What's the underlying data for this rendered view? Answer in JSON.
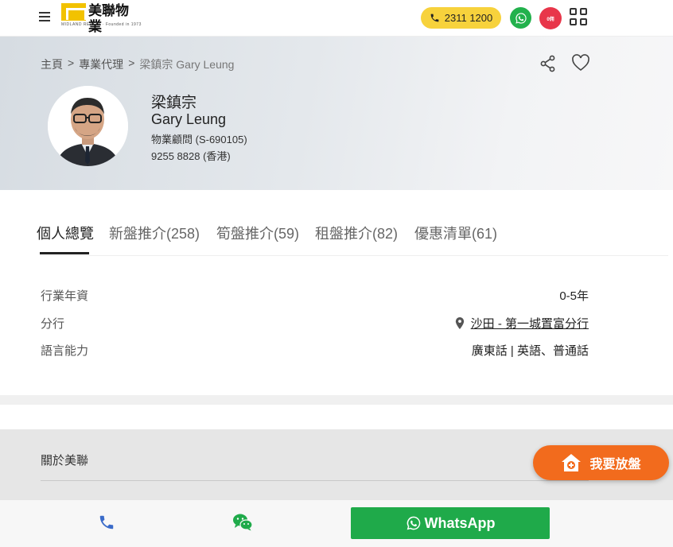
{
  "header": {
    "logo_text": "美聯物業",
    "logo_sub": "MIDLAND REALTY · Founded in 1973",
    "phone": "2311 1200",
    "red_badge": "0佣",
    "colors": {
      "phone_pill": "#f7d23c",
      "whatsapp": "#22b14c",
      "red_badge": "#e8364a",
      "accent": "#f26b1d"
    }
  },
  "breadcrumb": {
    "items": [
      "主頁",
      "專業代理",
      "梁鎮宗 Gary Leung"
    ],
    "separator": ">"
  },
  "agent": {
    "name_zh": "梁鎮宗",
    "name_en": "Gary Leung",
    "title": "物業顧問 (S-690105)",
    "phone": "9255 8828 (香港)"
  },
  "tabs": [
    {
      "label": "個人總覽",
      "active": true
    },
    {
      "label": "新盤推介(258)",
      "active": false
    },
    {
      "label": "筍盤推介(59)",
      "active": false
    },
    {
      "label": "租盤推介(82)",
      "active": false
    },
    {
      "label": "優惠清單(61)",
      "active": false
    }
  ],
  "info": {
    "experience_label": "行業年資",
    "experience_value": "0-5年",
    "branch_label": "分行",
    "branch_value": "沙田 - 第一城置富分行",
    "language_label": "語言能力",
    "language_value": "廣東話 | 英語、普通話"
  },
  "about": {
    "title": "關於美聯"
  },
  "list_button": {
    "label": "我要放盤"
  },
  "bottombar": {
    "whatsapp_label": "WhatsApp"
  },
  "icons": [
    "menu-icon",
    "phone-icon",
    "whatsapp-icon",
    "grid-icon",
    "share-icon",
    "heart-icon",
    "location-pin-icon",
    "house-plus-icon",
    "wechat-icon"
  ]
}
